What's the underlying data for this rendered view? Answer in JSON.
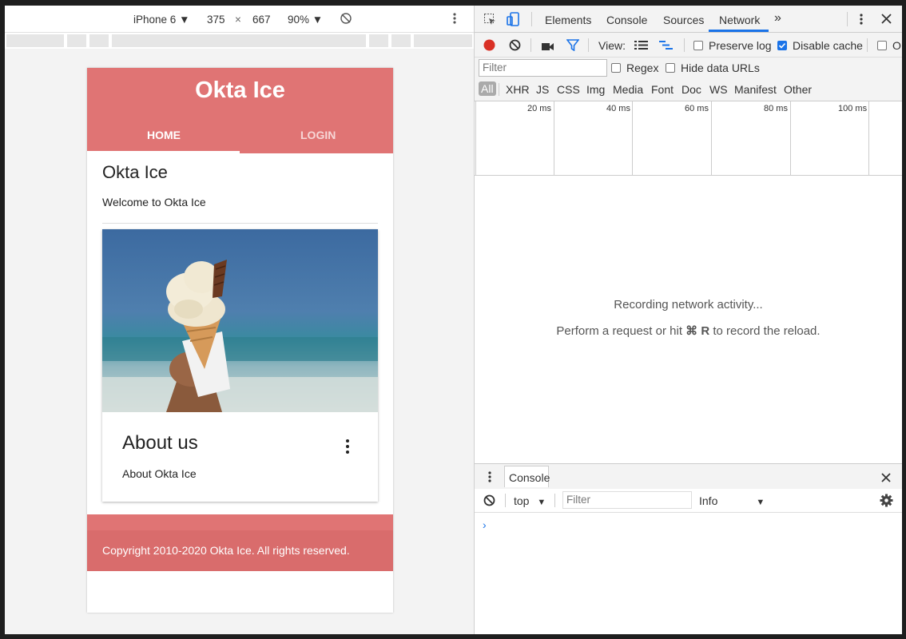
{
  "device_toolbar": {
    "device": "iPhone 6",
    "device_caret": "▼",
    "width": "375",
    "times": "×",
    "height": "667",
    "zoom": "90%",
    "zoom_caret": "▼"
  },
  "app": {
    "title": "Okta Ice",
    "tabs": [
      {
        "label": "HOME",
        "active": true
      },
      {
        "label": "LOGIN",
        "active": false
      }
    ],
    "page_heading": "Okta Ice",
    "page_text": "Welcome to Okta Ice",
    "card": {
      "title": "About us",
      "text": "About Okta Ice"
    },
    "footer": "Copyright 2010-2020 Okta Ice. All rights reserved.",
    "colors": {
      "primary": "#e07474",
      "footer": "#d96c6c"
    }
  },
  "devtools": {
    "tabs": [
      "Elements",
      "Console",
      "Sources",
      "Network"
    ],
    "active_tab": "Network",
    "more": "»",
    "toolbar": {
      "view_label": "View:",
      "preserve_log": "Preserve log",
      "preserve_log_checked": false,
      "disable_cache": "Disable cache",
      "disable_cache_checked": true,
      "offline_partial": "O"
    },
    "filter": {
      "placeholder": "Filter",
      "regex": "Regex",
      "hide_data_urls": "Hide data URLs"
    },
    "types": [
      "All",
      "XHR",
      "JS",
      "CSS",
      "Img",
      "Media",
      "Font",
      "Doc",
      "WS",
      "Manifest",
      "Other"
    ],
    "timeline_ticks": [
      "20 ms",
      "40 ms",
      "60 ms",
      "80 ms",
      "100 ms"
    ],
    "empty": {
      "line1": "Recording network activity...",
      "line2_pre": "Perform a request or hit ",
      "line2_key": "⌘ R",
      "line2_post": " to record the reload."
    },
    "drawer": {
      "tab": "Console",
      "context": "top",
      "filter_placeholder": "Filter",
      "level": "Info",
      "prompt": "›"
    }
  }
}
